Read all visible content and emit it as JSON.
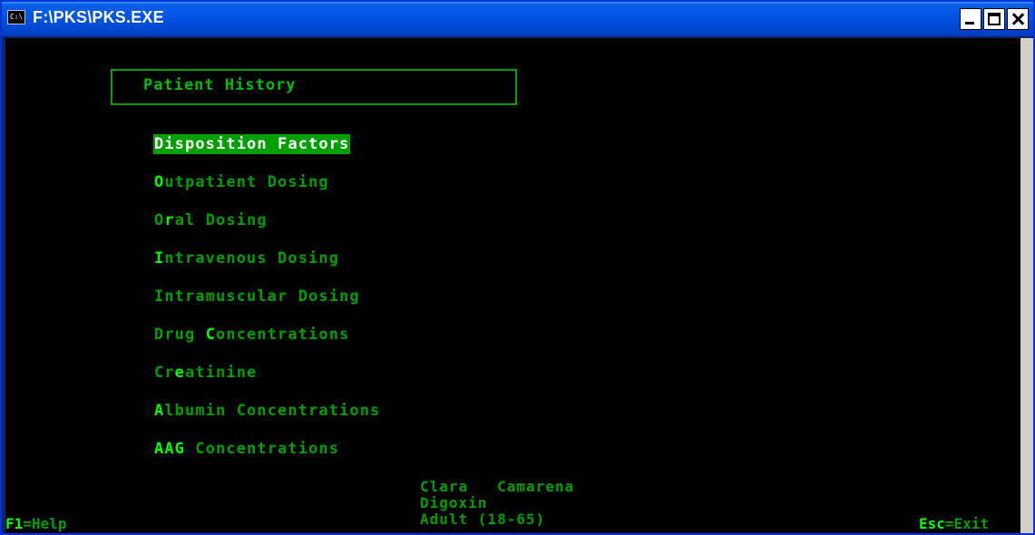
{
  "window": {
    "title": "F:\\PKS\\PKS.EXE",
    "icon_label": "C:\\",
    "icon": "console-icon"
  },
  "header": {
    "title": "Patient History"
  },
  "menu": {
    "items": [
      {
        "hotkey": "D",
        "prefix": "",
        "rest": "isposition Factors",
        "selected": true
      },
      {
        "hotkey": "O",
        "prefix": "",
        "rest": "utpatient Dosing",
        "selected": false
      },
      {
        "hotkey": "r",
        "prefix": "O",
        "rest": "al Dosing",
        "selected": false
      },
      {
        "hotkey": "I",
        "prefix": "",
        "rest": "ntravenous Dosing",
        "selected": false
      },
      {
        "hotkey": "",
        "prefix": "",
        "rest": "Intramuscular Dosing",
        "selected": false
      },
      {
        "hotkey": "C",
        "prefix": "Drug ",
        "rest": "oncentrations",
        "selected": false
      },
      {
        "hotkey": "e",
        "prefix": "Cr",
        "rest": "atinine",
        "selected": false
      },
      {
        "hotkey": "A",
        "prefix": "",
        "rest": "lbumin Concentrations",
        "selected": false
      },
      {
        "hotkey": "AAG",
        "prefix": "",
        "rest": " Concentrations",
        "selected": false
      }
    ]
  },
  "patient": {
    "first_name": "Clara",
    "last_name": "Camarena",
    "drug": "Digoxin",
    "age_group": "Adult (18-65)"
  },
  "footer": {
    "help_key": "F1",
    "help_label": "=Help",
    "exit_key": "Esc",
    "exit_label": "=Exit"
  },
  "colors": {
    "background": "#000000",
    "text_dim": "#00a000",
    "text_bright": "#00ff00",
    "highlight": "#00a000",
    "border": "#0a9a0a",
    "titlebar": "#0055e5"
  }
}
